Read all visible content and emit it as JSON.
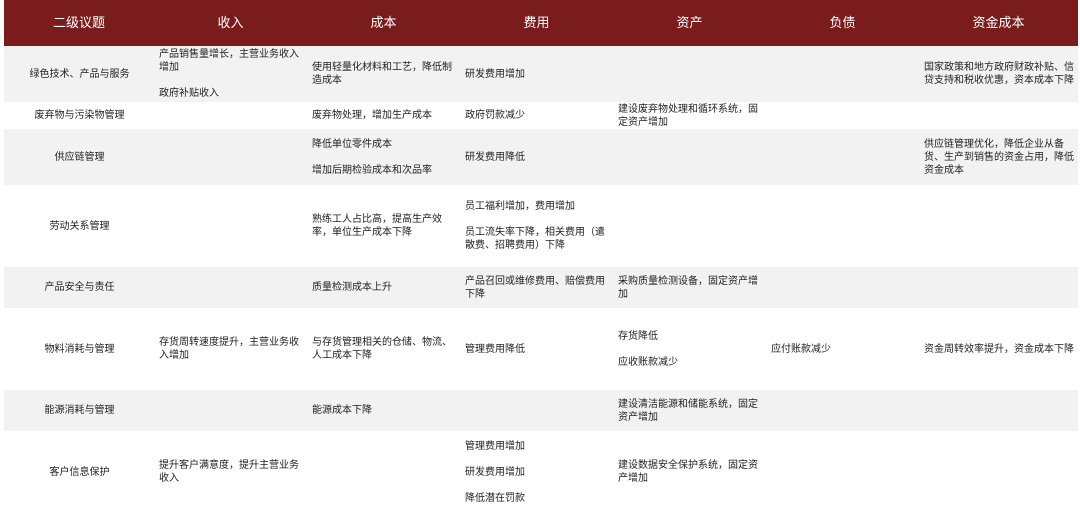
{
  "headers": [
    "二级议题",
    "收入",
    "成本",
    "费用",
    "资产",
    "负债",
    "资金成本"
  ],
  "rows": [
    {
      "topic": "绿色技术、产品与服务",
      "income": [
        "产品销售量增长，主营业务收入增加",
        "政府补贴收入"
      ],
      "cost": [
        "使用轻量化材料和工艺，降低制造成本"
      ],
      "expense": [
        "研发费用增加"
      ],
      "assets": [],
      "liabilities": [],
      "capital_cost": [
        "国家政策和地方政府财政补贴、信贷支持和税收优惠，资本成本下降"
      ]
    },
    {
      "topic": "废弃物与污染物管理",
      "income": [],
      "cost": [
        "废弃物处理，增加生产成本"
      ],
      "expense": [
        "政府罚款减少"
      ],
      "assets": [
        "建设废弃物处理和循环系统，固定资产增加"
      ],
      "liabilities": [],
      "capital_cost": []
    },
    {
      "topic": "供应链管理",
      "income": [],
      "cost": [
        "降低单位零件成本",
        "增加后期检验成本和次品率"
      ],
      "expense": [
        "研发费用降低"
      ],
      "assets": [],
      "liabilities": [],
      "capital_cost": [
        "供应链管理优化，降低企业从备货、生产到销售的资金占用，降低资金成本"
      ]
    },
    {
      "topic": "劳动关系管理",
      "income": [],
      "cost": [
        "熟练工人占比高，提高生产效率，单位生产成本下降"
      ],
      "expense": [
        "员工福利增加，费用增加",
        "员工流失率下降，相关费用（遣散费、招聘费用）下降"
      ],
      "assets": [],
      "liabilities": [],
      "capital_cost": []
    },
    {
      "topic": "产品安全与责任",
      "income": [],
      "cost": [
        "质量检测成本上升"
      ],
      "expense": [
        "产品召回或维修费用、赔偿费用下降"
      ],
      "assets": [
        "采购质量检测设备，固定资产增加"
      ],
      "liabilities": [],
      "capital_cost": []
    },
    {
      "topic": "物料消耗与管理",
      "income": [
        "存货周转速度提升，主营业务收入增加"
      ],
      "cost": [
        "与存货管理相关的仓储、物流、人工成本下降"
      ],
      "expense": [
        "管理费用降低"
      ],
      "assets": [
        "存货降低",
        "应收账款减少"
      ],
      "liabilities": [
        "应付账款减少"
      ],
      "capital_cost": [
        "资金周转效率提升，资金成本下降"
      ]
    },
    {
      "topic": "能源消耗与管理",
      "income": [],
      "cost": [
        "能源成本下降"
      ],
      "expense": [],
      "assets": [
        "建设清洁能源和储能系统，固定资产增加"
      ],
      "liabilities": [],
      "capital_cost": []
    },
    {
      "topic": "客户信息保护",
      "income": [
        "提升客户满意度，提升主营业务收入"
      ],
      "cost": [],
      "expense": [
        "管理费用增加",
        "研发费用增加",
        "降低潜在罚款"
      ],
      "assets": [
        "建设数据安全保护系统，固定资产增加"
      ],
      "liabilities": [],
      "capital_cost": []
    }
  ]
}
